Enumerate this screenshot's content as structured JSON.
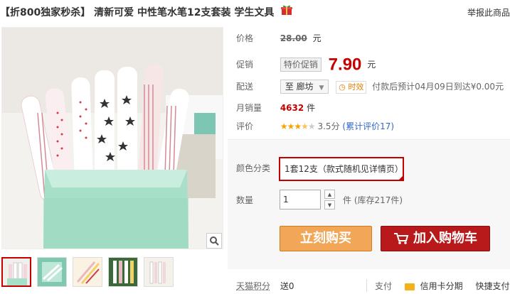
{
  "title": "【折800独家秒杀】 清新可爱 中性笔水笔12支套装 学生文具",
  "report_link": "举报此商品",
  "price": {
    "label": "价格",
    "original": "28.00",
    "currency": "元"
  },
  "promo": {
    "label": "促销",
    "tag": "特价促销",
    "price": "7.90",
    "currency": "元"
  },
  "shipping": {
    "label": "配送",
    "from": "至 廊坊",
    "badge": "时效",
    "text": "付款后预计04月09日到达¥0.00元"
  },
  "monthly_sales": {
    "label": "月销量",
    "count": "4632",
    "unit": "件"
  },
  "rating": {
    "label": "评价",
    "stars": 3.5,
    "stars_text": "★★★★★",
    "score": "3.5分",
    "review_link": "(累计评价17)"
  },
  "color": {
    "label": "颜色分类",
    "selected": "1套12支（款式随机见详情页）"
  },
  "quantity": {
    "label": "数量",
    "value": "1",
    "unit": "件",
    "stock": "(库存217件)"
  },
  "buttons": {
    "buy": "立刻购买",
    "cart": "加入购物车"
  },
  "bottom": {
    "points_label": "天猫积分",
    "points_value": "送0",
    "pay_label": "支付",
    "credit": "信用卡分期",
    "express": "快捷支付"
  },
  "colors": {
    "accent": "#c40000",
    "buy": "#f2a658",
    "cart": "#b8191b"
  }
}
